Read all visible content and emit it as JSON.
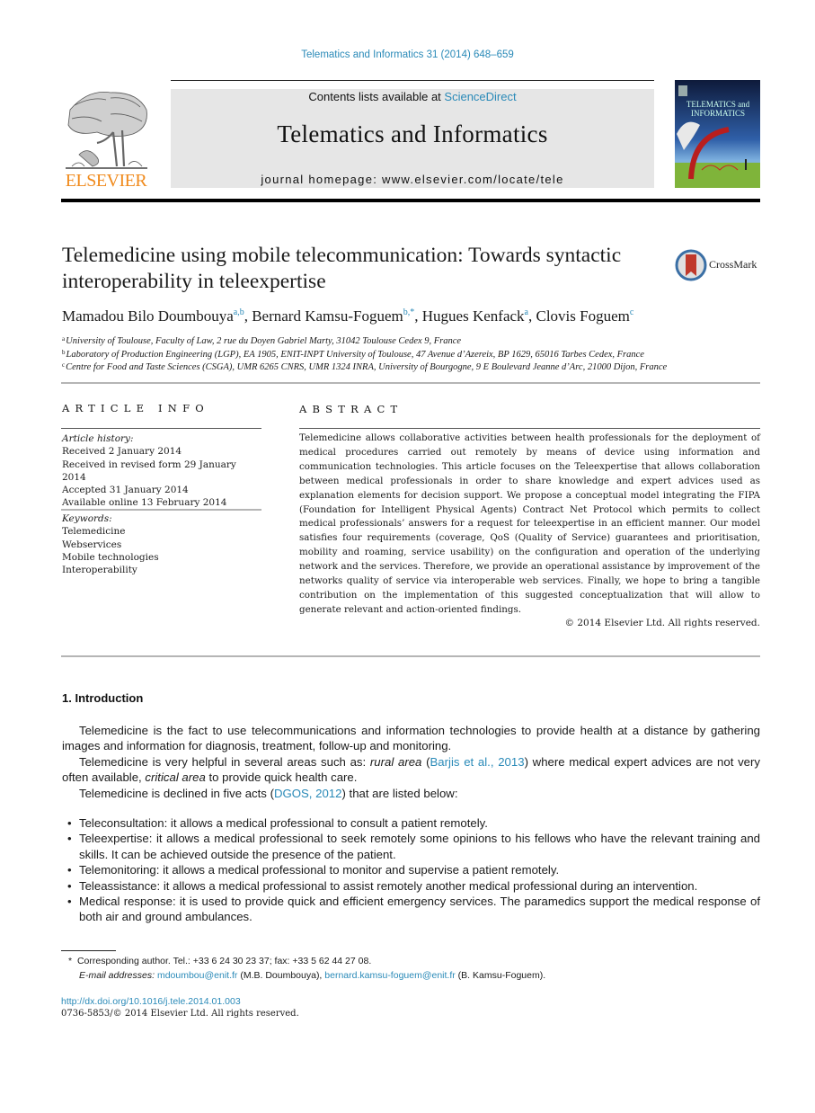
{
  "header": {
    "citation": "Telematics and Informatics 31 (2014) 648–659",
    "contents_prefix": "Contents lists available at ",
    "contents_link": "ScienceDirect",
    "journal_name": "Telematics and Informatics",
    "homepage": "journal homepage: www.elsevier.com/locate/tele",
    "publisher_logo_text": "ELSEVIER",
    "cover_title_line1": "TELEMATICS and",
    "cover_title_line2": "INFORMATICS"
  },
  "article": {
    "title": "Telemedicine using mobile telecommunication: Towards syntactic interoperability in teleexpertise",
    "crossmark_label": "CrossMark",
    "authors": [
      {
        "name": "Mamadou Bilo Doumbouya",
        "sup": "a,b"
      },
      {
        "name": "Bernard Kamsu-Foguem",
        "sup": "b,*"
      },
      {
        "name": "Hugues Kenfack",
        "sup": "a"
      },
      {
        "name": "Clovis Foguem",
        "sup": "c"
      }
    ],
    "author_separator": ", ",
    "affiliations": [
      {
        "key": "a",
        "text": "University of Toulouse, Faculty of Law, 2 rue du Doyen Gabriel Marty, 31042 Toulouse Cedex 9, France"
      },
      {
        "key": "b",
        "text": "Laboratory of Production Engineering (LGP), EA 1905, ENIT-INPT University of Toulouse, 47 Avenue d’Azereix, BP 1629, 65016 Tarbes Cedex, France"
      },
      {
        "key": "c",
        "text": "Centre for Food and Taste Sciences (CSGA), UMR 6265 CNRS, UMR 1324 INRA, University of Bourgogne, 9 E Boulevard Jeanne d’Arc, 21000 Dijon, France"
      }
    ]
  },
  "article_info": {
    "heading": "ARTICLE INFO",
    "history_label": "Article history:",
    "history": [
      "Received 2 January 2014",
      "Received in revised form 29 January 2014",
      "Accepted 31 January 2014",
      "Available online 13 February 2014"
    ],
    "keywords_label": "Keywords:",
    "keywords": [
      "Telemedicine",
      "Webservices",
      "Mobile technologies",
      "Interoperability"
    ]
  },
  "abstract": {
    "heading": "ABSTRACT",
    "text": "Telemedicine allows collaborative activities between health professionals for the deploy­ment of medical procedures carried out remotely by means of device using information and communication technologies. This article focuses on the Teleexpertise that allows col­laboration between medical professionals in order to share knowledge and expert advices used as explanation elements for decision support. We propose a conceptual model integrat­ing the FIPA (Foundation for Intelligent Physical Agents) Contract Net Protocol which per­mits to collect medical professionals’ answers for a request for teleexpertise in an efficient manner. Our model satisfies four requirements (coverage, QoS (Quality of Service) guaran­tees and prioritisation, mobility and roaming, service usability) on the configuration and operation of the underlying network and the services. Therefore, we provide an operational assistance by improvement of the networks quality of service via interoperable web services. Finally, we hope to bring a tangible contribution on the implementation of this suggested conceptualization that will allow to generate relevant and action-oriented findings.",
    "copyright": "© 2014 Elsevier Ltd. All rights reserved."
  },
  "introduction": {
    "heading": "1. Introduction",
    "p1": "Telemedicine is the fact to use telecommunications and information technologies to provide health at a distance by gathering images and information for diagnosis, treatment, follow-up and monitoring.",
    "p2_a": "Telemedicine is very helpful in several areas such as: ",
    "p2_em1": "rural area",
    "p2_b": " (",
    "p2_ref": "Barjis et al., 2013",
    "p2_c": ") where medical expert advices are not very often available, ",
    "p2_em2": "critical area",
    "p2_d": " to provide quick health care.",
    "p3_a": "Telemedicine is declined in five acts (",
    "p3_ref": "DGOS, 2012",
    "p3_b": ") that are listed below:",
    "bullet_glyph": "•",
    "bullets": [
      "Teleconsultation: it allows a medical professional to consult a patient remotely.",
      "Teleexpertise: it allows a medical professional to seek remotely some opinions to his fellows who have the relevant training and skills. It can be achieved outside the presence of the patient.",
      "Telemonitoring: it allows a medical professional to monitor and supervise a patient remotely.",
      "Teleassistance: it allows a medical professional to assist remotely another medical professional during an intervention.",
      "Medical response: it is used to provide quick and efficient emergency services. The paramedics support the medical response of both air and ground ambulances."
    ]
  },
  "footnotes": {
    "marker": "*",
    "corresponding": "Corresponding author. Tel.: +33 6 24 30 23 37; fax: +33 5 62 44 27 08.",
    "email_label": "E-mail addresses:",
    "email1": "mdoumbou@enit.fr",
    "email1_owner": " (M.B. Doumbouya), ",
    "email2": "bernard.kamsu-foguem@enit.fr",
    "email2_owner": " (B. Kamsu-Foguem).",
    "doi": "http://dx.doi.org/10.1016/j.tele.2014.01.003",
    "issn": "0736-5853/© 2014 Elsevier Ltd. All rights reserved."
  },
  "colors": {
    "link": "#2a8ab8",
    "elsevier_orange": "#f08a1c",
    "header_box": "#e6e6e6"
  }
}
